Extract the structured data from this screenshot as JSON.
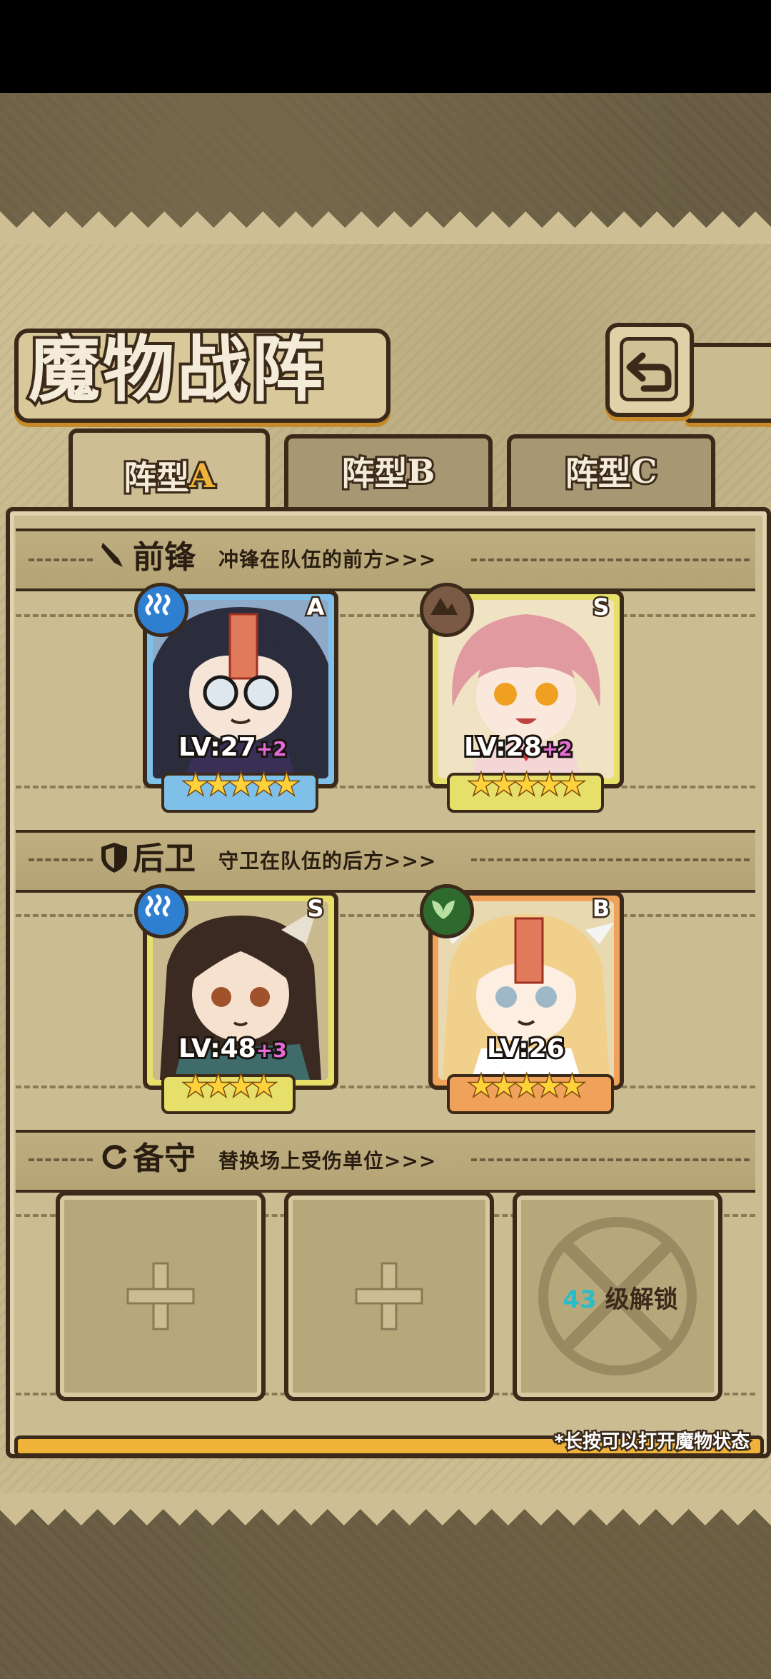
{
  "title": "魔物战阵",
  "tabs": [
    {
      "prefix": "阵型",
      "suffix": "A",
      "active": true
    },
    {
      "prefix": "阵型",
      "suffix": "B",
      "active": false
    },
    {
      "prefix": "阵型",
      "suffix": "C",
      "active": false
    }
  ],
  "sections": {
    "front": {
      "title": "前锋",
      "subtitle": "冲锋在队伍的前方>>>",
      "icon": "sword-icon"
    },
    "back": {
      "title": "后卫",
      "subtitle": "守卫在队伍的后方>>>",
      "icon": "shield-icon"
    },
    "reserve": {
      "title": "备守",
      "subtitle": "替换场上受伤单位>>>",
      "icon": "swap-icon"
    }
  },
  "cards": [
    {
      "rank": "A",
      "element": "water-icon",
      "level": "LV:27",
      "bonus": "+2",
      "stars": 5,
      "frame_color": "#7fc0e8",
      "element_color": "#2f7fd0"
    },
    {
      "rank": "S",
      "element": "earth-icon",
      "level": "LV:28",
      "bonus": "+2",
      "stars": 5,
      "frame_color": "#e6e06a",
      "element_color": "#7a5a44"
    },
    {
      "rank": "S",
      "element": "water-icon",
      "level": "LV:48",
      "bonus": "+3",
      "stars": 4,
      "frame_color": "#e6e06a",
      "element_color": "#2f7fd0"
    },
    {
      "rank": "B",
      "element": "wood-icon",
      "level": "LV:26",
      "bonus": "",
      "stars": 5,
      "frame_color": "#f0a25a",
      "element_color": "#2e6a2e"
    }
  ],
  "reserve_slots": [
    {
      "state": "empty"
    },
    {
      "state": "empty"
    },
    {
      "state": "locked",
      "unlock_level": "43",
      "unlock_text": "级解锁"
    }
  ],
  "hint": "*长按可以打开魔物状态",
  "colors": {
    "accent": "#f0b33a",
    "outline": "#3b2a1a",
    "parchment": "#cdbf93"
  }
}
